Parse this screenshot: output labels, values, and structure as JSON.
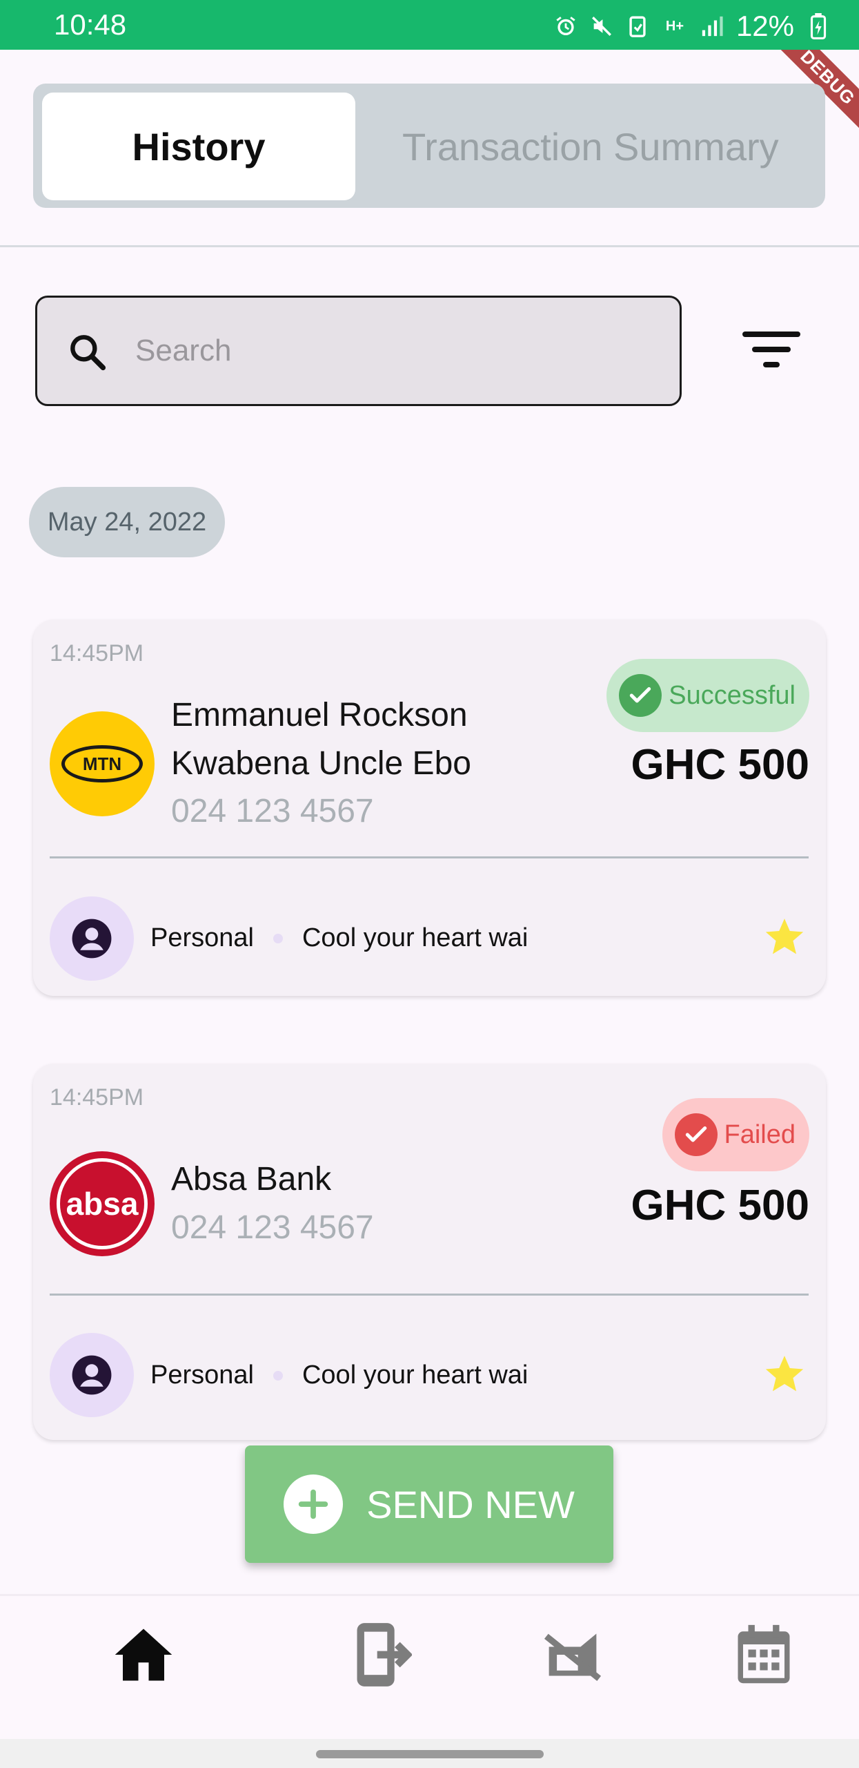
{
  "status_bar": {
    "time": "10:48",
    "battery": "12%",
    "network_label": "H+",
    "icons": [
      "alarm-icon",
      "mute-icon",
      "data-saver-icon",
      "signal-icon",
      "battery-charging-icon"
    ]
  },
  "debug_banner": "DEBUG",
  "tabs": {
    "active": "History",
    "inactive": "Transaction Summary"
  },
  "search": {
    "placeholder": "Search",
    "value": ""
  },
  "date_group": "May 24, 2022",
  "transactions": [
    {
      "time": "14:45PM",
      "logo_text": "MTN",
      "name_line1": "Emmanuel Rockson",
      "name_line2": "Kwabena Uncle Ebo",
      "phone": "024 123 4567",
      "status": "Successful",
      "amount": "GHC 500",
      "category": "Personal",
      "note": "Cool your heart wai",
      "favorite": true
    },
    {
      "time": "14:45PM",
      "logo_text": "absa",
      "name_line1": "Absa Bank",
      "phone": "024 123 4567",
      "status": "Failed",
      "amount": "GHC 500",
      "category": "Personal",
      "note": "Cool your heart wai",
      "favorite": true
    }
  ],
  "send_new": {
    "label": "SEND NEW"
  },
  "bottom_nav": [
    "home-icon",
    "transfer-out-icon",
    "send-icon",
    "calendar-icon"
  ],
  "colors": {
    "status_bar": "#17b86c",
    "success": "#4aa85a",
    "failed": "#e34c4c",
    "send_new": "#81c784",
    "star": "#fbe541"
  }
}
